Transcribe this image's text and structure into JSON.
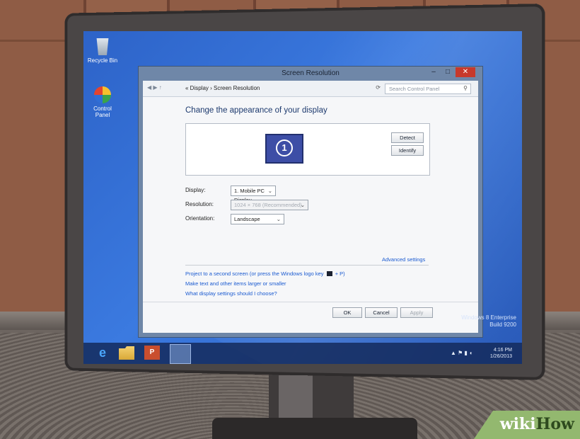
{
  "desktop": {
    "icons": [
      {
        "label": "Recycle Bin",
        "icon": "recycle-bin-icon"
      },
      {
        "label": "Control Panel",
        "icon": "control-panel-icon"
      }
    ]
  },
  "window": {
    "title": "Screen Resolution",
    "address": {
      "breadcrumb": "« Display › Screen Resolution",
      "search_placeholder": "Search Control Panel"
    },
    "heading": "Change the appearance of your display",
    "preview": {
      "monitor_number": "1",
      "detect_label": "Detect",
      "identify_label": "Identify"
    },
    "fields": {
      "display_label": "Display:",
      "display_value": "1. Mobile PC Display",
      "resolution_label": "Resolution:",
      "resolution_value": "1024 × 768 (Recommended)",
      "orientation_label": "Orientation:",
      "orientation_value": "Landscape"
    },
    "advanced_label": "Advanced settings",
    "links": {
      "project_text": "Project to a second screen (or press the Windows logo key",
      "project_suffix": "+ P)",
      "text_size": "Make text and other items larger or smaller",
      "which_settings": "What display settings should I choose?"
    },
    "buttons": {
      "ok": "OK",
      "cancel": "Cancel",
      "apply": "Apply"
    }
  },
  "watermark": {
    "line1": "Windows 8 Enterprise",
    "line2": "Build 9200"
  },
  "taskbar": {
    "clock_time": "4:16 PM",
    "clock_date": "1/26/2013"
  },
  "brand": {
    "wiki": "wiki",
    "how": "How"
  },
  "colors": {
    "desktop_blue": "#2d63c8",
    "link_blue": "#1a5ad0",
    "close_red": "#c7392b",
    "wikihow_green": "#93b86f"
  }
}
